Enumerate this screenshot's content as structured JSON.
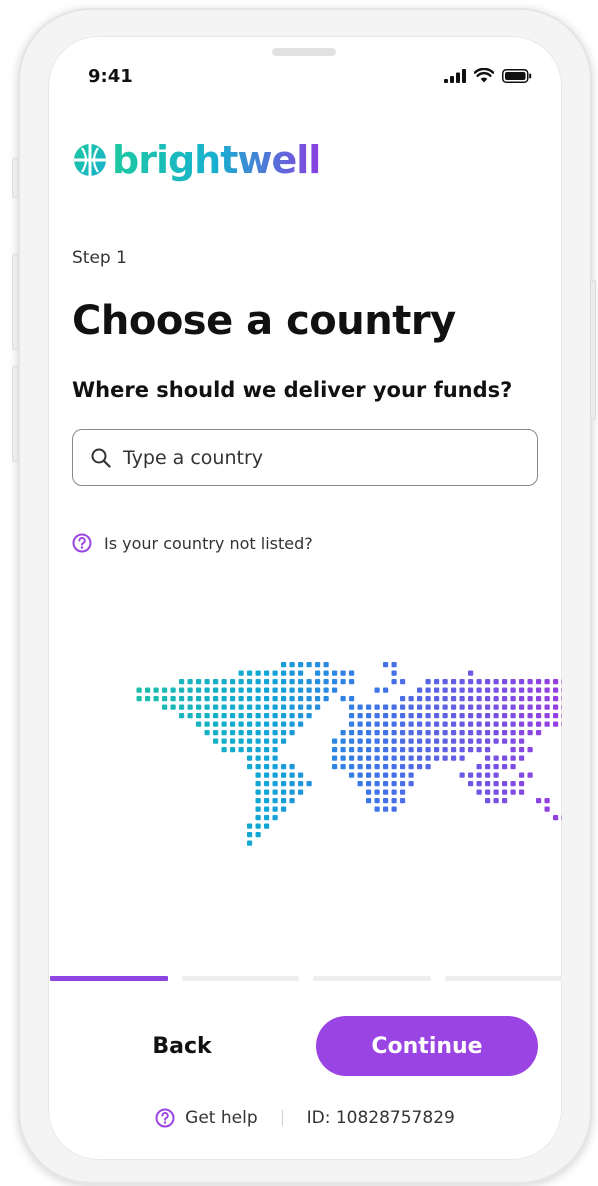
{
  "status_bar": {
    "time": "9:41"
  },
  "brand": {
    "name": "brightwell"
  },
  "step": {
    "label": "Step 1"
  },
  "page": {
    "title": "Choose a country",
    "subtitle": "Where should we deliver your funds?"
  },
  "search": {
    "placeholder": "Type a country",
    "value": ""
  },
  "help_link": {
    "label": "Is your country not listed?"
  },
  "progress": {
    "total_steps": 4,
    "current_step": 1
  },
  "actions": {
    "back_label": "Back",
    "continue_label": "Continue"
  },
  "footer": {
    "help_label": "Get help",
    "id_text": "ID: 10828757829"
  },
  "colors": {
    "accent": "#9a44e3",
    "brand_gradient_start": "#1ec9a1",
    "brand_gradient_mid": "#17b0cf",
    "brand_gradient_end": "#8a3fe0",
    "progress_active": "#8e44e0",
    "progress_inactive": "#eeeeee"
  },
  "icons": {
    "search": "search-icon",
    "help": "question-circle-icon",
    "logo": "globe-logo-icon",
    "signal": "signal-icon",
    "wifi": "wifi-icon",
    "battery": "battery-icon"
  }
}
